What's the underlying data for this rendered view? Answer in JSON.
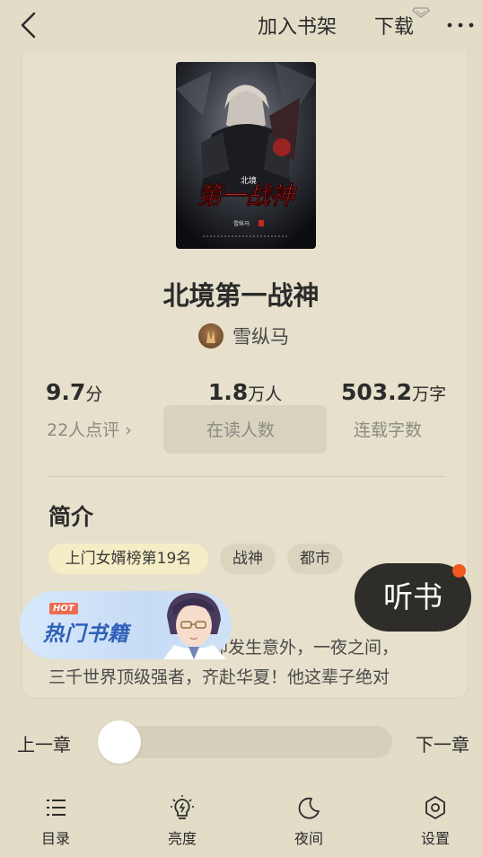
{
  "topbar": {
    "add_to_shelf": "加入书架",
    "download": "下载"
  },
  "book": {
    "title": "北境第一战神",
    "author": "雪纵马",
    "cover": {
      "small_title": "北境",
      "big_title": "第一战神",
      "author_small": "雪纵马"
    }
  },
  "stats": [
    {
      "value": "9.7",
      "unit": "分",
      "label": "22人点评 ›"
    },
    {
      "value": "1.8",
      "unit": "万人",
      "label": "在读人数"
    },
    {
      "value": "503.2",
      "unit": "万字",
      "label": "连载字数"
    }
  ],
  "intro": {
    "heading": "简介",
    "tags": [
      "上门女婿榜第19名",
      "战神",
      "都市"
    ],
    "line1_tail": "却发生意外，一夜之间，",
    "line2": "三千世界顶级强者，齐赴华夏！他这辈子绝对"
  },
  "listen": {
    "label": "听书"
  },
  "banner": {
    "hot": "HOT",
    "text": "热门书籍"
  },
  "reader": {
    "prev": "上一章",
    "next": "下一章",
    "progress": 0.0
  },
  "tabs": [
    {
      "label": "目录",
      "icon": "list-icon"
    },
    {
      "label": "亮度",
      "icon": "bulb-icon"
    },
    {
      "label": "夜间",
      "icon": "moon-icon"
    },
    {
      "label": "设置",
      "icon": "hexagon-settings-icon"
    }
  ],
  "colors": {
    "background": "#e3ddc8",
    "listen_button": "#2e2d29",
    "notification_dot": "#f2571e",
    "hot_tag": "#f5edc6",
    "banner_text": "#2f5fb8"
  }
}
